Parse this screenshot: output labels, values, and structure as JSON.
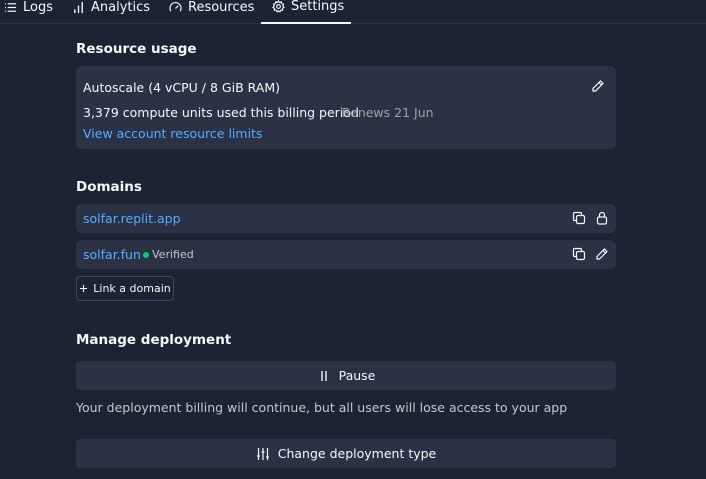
{
  "tabs": [
    {
      "label": "Logs",
      "icon": "list-icon"
    },
    {
      "label": "Analytics",
      "icon": "bar-chart-icon"
    },
    {
      "label": "Resources",
      "icon": "gauge-icon"
    },
    {
      "label": "Settings",
      "icon": "gear-icon",
      "active": true
    }
  ],
  "resource_usage": {
    "title": "Resource usage",
    "plan": "Autoscale (4 vCPU / 8 GiB RAM)",
    "units": "3,379 compute units used this billing period",
    "renews": "Renews 21 Jun",
    "limits_link": "View account resource limits"
  },
  "domains": {
    "title": "Domains",
    "items": [
      {
        "name": "solfar.replit.app",
        "badge": "",
        "action_icon": "lock-icon"
      },
      {
        "name": "solfar.fun",
        "badge": "Verified",
        "action_icon": "pencil-icon"
      }
    ],
    "link_button": "Link a domain"
  },
  "manage": {
    "title": "Manage deployment",
    "pause_label": "Pause",
    "warning": "Your deployment billing will continue, but all users will lose access to your app",
    "change_type_label": "Change deployment type"
  },
  "colors": {
    "background": "#1c2333",
    "card": "#2b3245",
    "link": "#57abff",
    "verified": "#0cce6b"
  }
}
